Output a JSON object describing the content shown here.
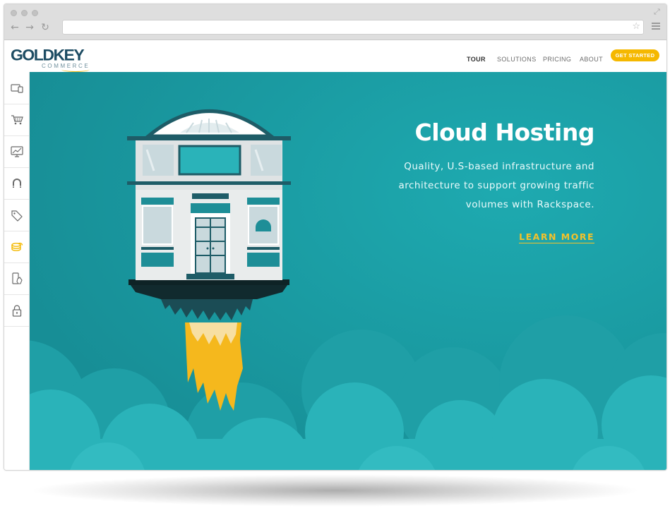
{
  "colors": {
    "brand_navy": "#1d4c63",
    "accent_gold": "#f5b800",
    "hero_teal": "#1a9ba0",
    "cloud_teal": "#2ab3b9",
    "flame_yellow": "#f3bd1b"
  },
  "browser": {
    "url": "",
    "star_icon": "star-icon",
    "menu_icon": "hamburger-menu-icon"
  },
  "header": {
    "logo_main": "GOLDKEY",
    "logo_sub": "COMMERCE",
    "nav": [
      {
        "label": "TOUR",
        "active": true
      },
      {
        "label": "SOLUTIONS",
        "active": false
      },
      {
        "label": "PRICING",
        "active": false
      },
      {
        "label": "ABOUT",
        "active": false
      }
    ],
    "cta_label": "GET STARTED"
  },
  "sidebar": {
    "items": [
      {
        "icon": "devices-icon",
        "active": false
      },
      {
        "icon": "shopping-cart-icon",
        "active": false
      },
      {
        "icon": "monitor-chart-icon",
        "active": false
      },
      {
        "icon": "magnet-icon",
        "active": false
      },
      {
        "icon": "price-tag-icon",
        "active": false
      },
      {
        "icon": "cloud-database-icon",
        "active": true
      },
      {
        "icon": "mobile-touch-icon",
        "active": false
      },
      {
        "icon": "lock-icon",
        "active": false
      }
    ]
  },
  "hero": {
    "title": "Cloud Hosting",
    "description": "Quality, U.S-based infrastructure and architecture to support growing traffic volumes with Rackspace.",
    "link_label": "LEARN MORE",
    "illustration": "rocket-storefront-illustration"
  }
}
